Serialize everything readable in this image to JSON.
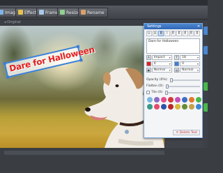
{
  "toolbar": {
    "buttons": [
      {
        "label": "Image",
        "color": "#7fb3e6"
      },
      {
        "label": "Effect",
        "color": "#e7c24a"
      },
      {
        "label": "Frame",
        "color": "#a7c9e8"
      },
      {
        "label": "Resize",
        "color": "#8fd18f"
      },
      {
        "label": "Rename",
        "color": "#d9a06a"
      }
    ]
  },
  "canvas": {
    "label": "Original",
    "watermark": "Dare for Halloween"
  },
  "settings": {
    "title": "Settings",
    "close": "✕",
    "format_buttons": [
      "U",
      "U",
      "B",
      "I",
      "E",
      "E",
      "E",
      "E",
      "E"
    ],
    "text_value": "Dare for Halloween",
    "font": {
      "name": "Impact",
      "size": "18"
    },
    "color": "0",
    "outline": "0",
    "opacity_label": "Opacity (0%):",
    "shadow_label": "Flatten (0):",
    "tile_label": "Tile (0):",
    "position": "Normal",
    "preset": "Normal",
    "delete_label": "Delete Text"
  },
  "colors": {
    "accent": "#2e66b5",
    "watermark_red": "#e41f1f",
    "watermark_frame": "#3a7fd8"
  }
}
